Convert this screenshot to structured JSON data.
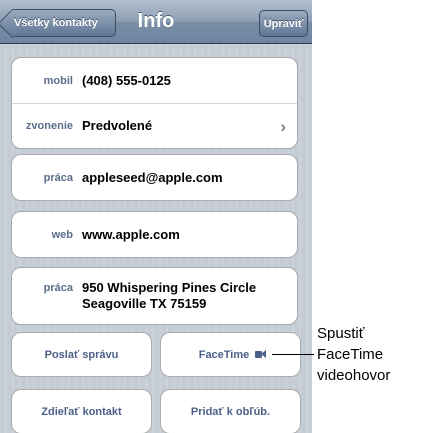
{
  "navbar": {
    "back_label": "Všetky kontakty",
    "title": "Info",
    "edit_label": "Upraviť"
  },
  "phone_group": {
    "mobile_label": "mobil",
    "mobile_value": "(408) 555-0125",
    "ringtone_label": "zvonenie",
    "ringtone_value": "Predvolené"
  },
  "email": {
    "label": "práca",
    "value": "appleseed@apple.com"
  },
  "web": {
    "label": "web",
    "value": "www.apple.com"
  },
  "address": {
    "label": "práca",
    "line1": "950 Whispering Pines Circle",
    "line2": "Seagoville TX 75159"
  },
  "actions": {
    "send_message": "Poslať správu",
    "facetime": "FaceTime",
    "share_contact": "Zdieľať kontakt",
    "add_favorites": "Pridať k obľúb."
  },
  "callout": {
    "line1": "Spustiť",
    "line2": "FaceTime",
    "line3": "videohovor"
  }
}
